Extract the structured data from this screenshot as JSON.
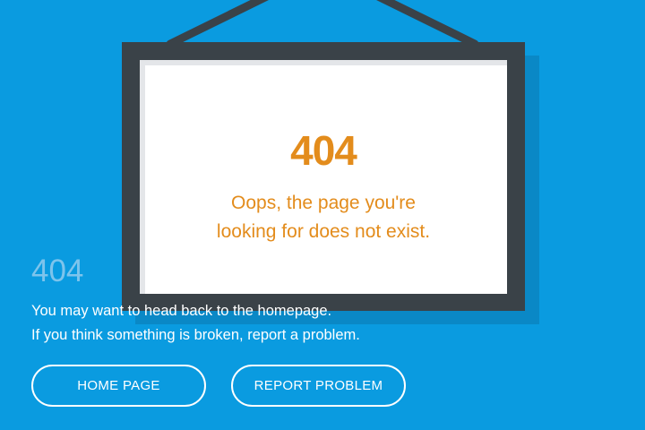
{
  "frame": {
    "code": "404",
    "message_line1": "Oops, the page you're",
    "message_line2": "looking for does not exist."
  },
  "error": {
    "code": "404",
    "line1": "You may want to head back to the homepage.",
    "line2": "If you think something is broken, report a problem."
  },
  "buttons": {
    "home_label": "HOME PAGE",
    "report_label": "REPORT PROBLEM"
  },
  "colors": {
    "background": "#0a9be0",
    "frame": "#3a4248",
    "accent": "#e38c1c",
    "faded_code": "#7dc4ec",
    "text": "#ffffff"
  }
}
